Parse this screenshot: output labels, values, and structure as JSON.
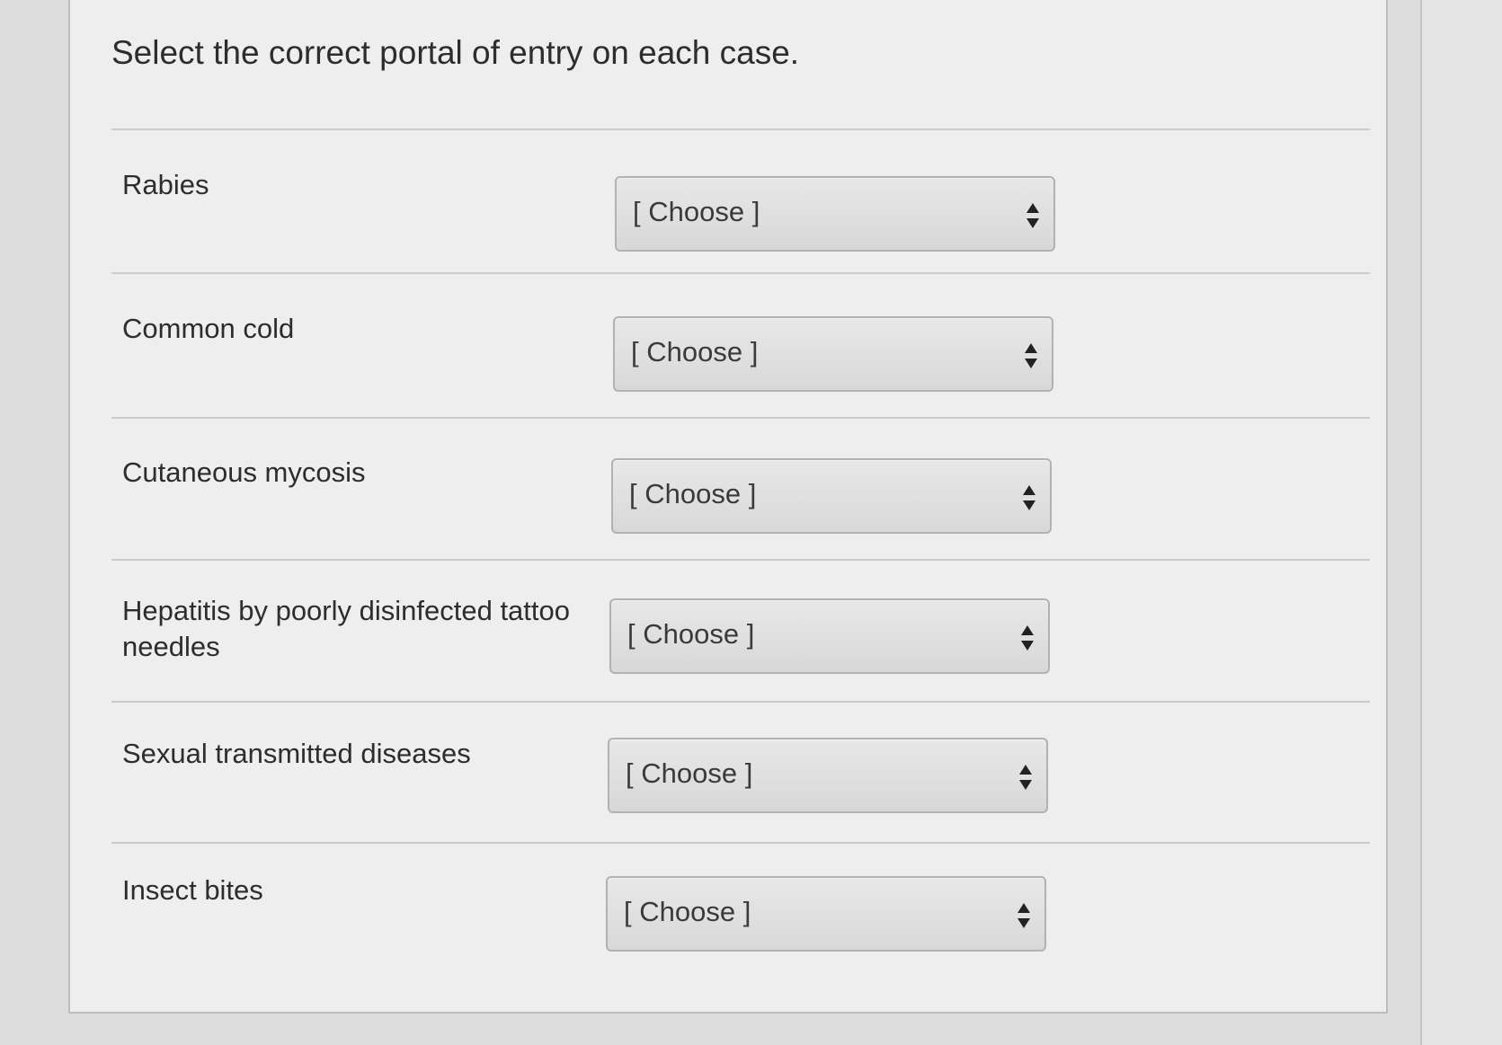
{
  "question": {
    "prompt": "Select the correct portal of entry on each case."
  },
  "rows": [
    {
      "label": "Rabies",
      "selected": "[ Choose ]"
    },
    {
      "label": "Common cold",
      "selected": "[ Choose ]"
    },
    {
      "label": "Cutaneous mycosis",
      "selected": "[ Choose ]"
    },
    {
      "label": "Hepatitis by poorly disinfected tattoo needles",
      "selected": "[ Choose ]"
    },
    {
      "label": "Sexual transmitted diseases",
      "selected": "[ Choose ]"
    },
    {
      "label": "Insect bites",
      "selected": "[ Choose ]"
    }
  ],
  "icons": {
    "dropdown": "up-down-arrows-icon"
  },
  "colors": {
    "background": "#eeeeee",
    "text": "#2d2d2d",
    "select_fill": "#dedede",
    "select_border": "#b2b2b2"
  }
}
